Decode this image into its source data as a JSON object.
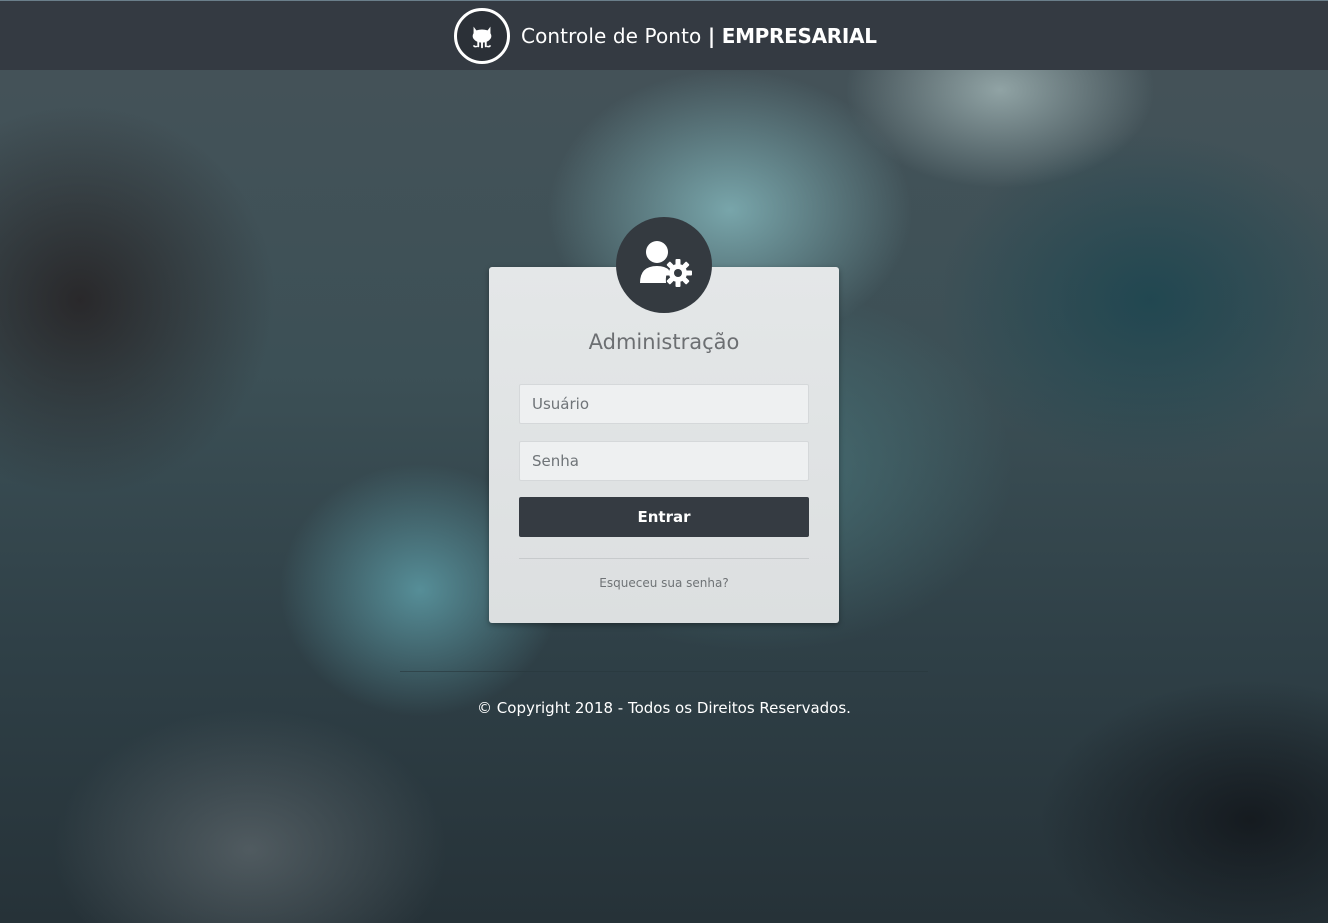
{
  "header": {
    "logo_icon": "octocat-icon",
    "title_regular": "Controle de Ponto",
    "title_separator": "|",
    "title_bold": "EMPRESARIAL"
  },
  "login": {
    "avatar_icon": "user-gear-icon",
    "title": "Administração",
    "username": {
      "value": "",
      "placeholder": "Usuário"
    },
    "password": {
      "value": "",
      "placeholder": "Senha"
    },
    "submit_label": "Entrar",
    "forgot_link": "Esqueceu sua senha?"
  },
  "footer": {
    "copyright": "© Copyright 2018 - Todos os Direitos Reservados."
  },
  "colors": {
    "header_bg": "#343a42",
    "button_bg": "#353b42",
    "card_bg": "#e4e7e8",
    "avatar_bg": "#343a40"
  }
}
